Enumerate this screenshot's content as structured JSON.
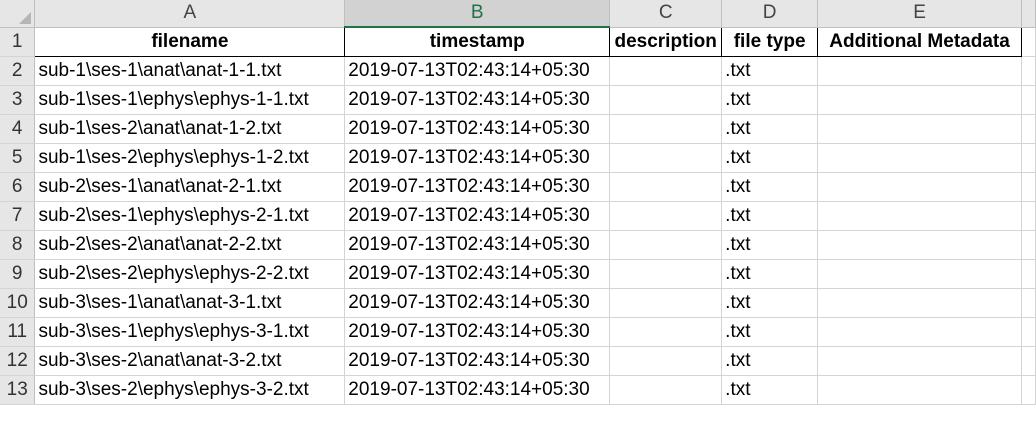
{
  "columns": [
    "A",
    "B",
    "C",
    "D",
    "E"
  ],
  "selected_column": "B",
  "header_row": {
    "row_number": "1",
    "cells": [
      "filename",
      "timestamp",
      "description",
      "file type",
      "Additional Metadata"
    ]
  },
  "rows": [
    {
      "n": "2",
      "filename": "sub-1\\ses-1\\anat\\anat-1-1.txt",
      "timestamp": "2019-07-13T02:43:14+05:30",
      "description": "",
      "file_type": ".txt",
      "metadata": ""
    },
    {
      "n": "3",
      "filename": "sub-1\\ses-1\\ephys\\ephys-1-1.txt",
      "timestamp": "2019-07-13T02:43:14+05:30",
      "description": "",
      "file_type": ".txt",
      "metadata": ""
    },
    {
      "n": "4",
      "filename": "sub-1\\ses-2\\anat\\anat-1-2.txt",
      "timestamp": "2019-07-13T02:43:14+05:30",
      "description": "",
      "file_type": ".txt",
      "metadata": ""
    },
    {
      "n": "5",
      "filename": "sub-1\\ses-2\\ephys\\ephys-1-2.txt",
      "timestamp": "2019-07-13T02:43:14+05:30",
      "description": "",
      "file_type": ".txt",
      "metadata": ""
    },
    {
      "n": "6",
      "filename": "sub-2\\ses-1\\anat\\anat-2-1.txt",
      "timestamp": "2019-07-13T02:43:14+05:30",
      "description": "",
      "file_type": ".txt",
      "metadata": ""
    },
    {
      "n": "7",
      "filename": "sub-2\\ses-1\\ephys\\ephys-2-1.txt",
      "timestamp": "2019-07-13T02:43:14+05:30",
      "description": "",
      "file_type": ".txt",
      "metadata": ""
    },
    {
      "n": "8",
      "filename": "sub-2\\ses-2\\anat\\anat-2-2.txt",
      "timestamp": "2019-07-13T02:43:14+05:30",
      "description": "",
      "file_type": ".txt",
      "metadata": ""
    },
    {
      "n": "9",
      "filename": "sub-2\\ses-2\\ephys\\ephys-2-2.txt",
      "timestamp": "2019-07-13T02:43:14+05:30",
      "description": "",
      "file_type": ".txt",
      "metadata": ""
    },
    {
      "n": "10",
      "filename": "sub-3\\ses-1\\anat\\anat-3-1.txt",
      "timestamp": "2019-07-13T02:43:14+05:30",
      "description": "",
      "file_type": ".txt",
      "metadata": ""
    },
    {
      "n": "11",
      "filename": "sub-3\\ses-1\\ephys\\ephys-3-1.txt",
      "timestamp": "2019-07-13T02:43:14+05:30",
      "description": "",
      "file_type": ".txt",
      "metadata": ""
    },
    {
      "n": "12",
      "filename": "sub-3\\ses-2\\anat\\anat-3-2.txt",
      "timestamp": "2019-07-13T02:43:14+05:30",
      "description": "",
      "file_type": ".txt",
      "metadata": ""
    },
    {
      "n": "13",
      "filename": "sub-3\\ses-2\\ephys\\ephys-3-2.txt",
      "timestamp": "2019-07-13T02:43:14+05:30",
      "description": "",
      "file_type": ".txt",
      "metadata": ""
    }
  ],
  "colors": {
    "selected_header_accent": "#217346",
    "header_bg": "#e6e6e6",
    "gridline": "#d4d4d4"
  }
}
